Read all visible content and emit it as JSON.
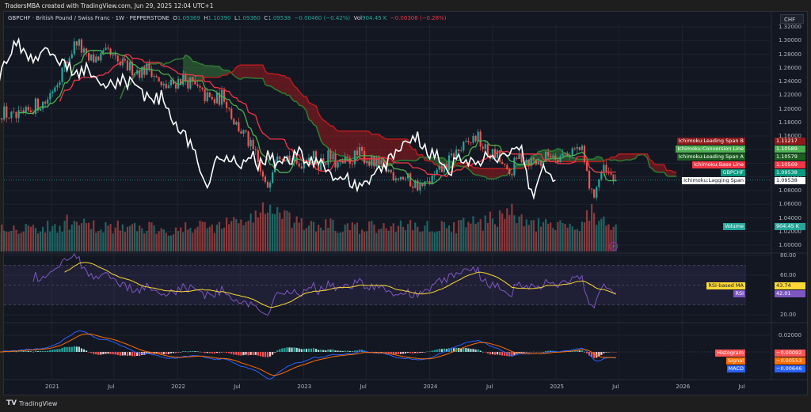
{
  "header": {
    "credit": "TradersMBA created with TradingView.com, Jun 29, 2025 12:04 UTC+1",
    "symbol": "GBPCHF · British Pound / Swiss Franc · 1W · PEPPERSTONE",
    "o_label": "O",
    "o": "1.09369",
    "h_label": "H",
    "h": "1.10390",
    "l_label": "L",
    "l": "1.09360",
    "c_label": "C",
    "c": "1.09538",
    "change": "−0.00460 (−0.42%)",
    "vol_label": "Vol",
    "vol": "904.45 K",
    "vol_change": "−0.00308 (−0.28%)"
  },
  "currency_button": "CHF",
  "footer": {
    "logo": "TV",
    "brand": "TradingView"
  },
  "colors": {
    "background": "#131722",
    "up": "#26a69a",
    "down": "#ef5350",
    "conversion": "#4caf50",
    "base": "#f23645",
    "span_a": "#2e7d32",
    "span_b": "#b71c1c",
    "lagging": "#ffffff",
    "rsi": "#7e57c2",
    "rsi_ma": "#fdd835",
    "macd": "#2962ff",
    "signal": "#ff6d00",
    "hist_pos": "#26a69a",
    "hist_neg": "#ff5252"
  },
  "labels": {
    "span_b": {
      "name": "Ichimoku:Leading Span B",
      "value": "1.11217"
    },
    "conversion": {
      "name": "Ichimoku:Conversion Line",
      "value": "1.10589"
    },
    "span_a": {
      "name": "Ichimoku:Leading Span A",
      "value": "1.10579"
    },
    "base": {
      "name": "Ichimoku:Base Line",
      "value": "1.10569"
    },
    "price": {
      "name": "GBPCHF",
      "value": "1.09538"
    },
    "lagging": {
      "name": "Ichimoku:Lagging Span",
      "value": "1.09538"
    },
    "volume": {
      "name": "Volume",
      "value": "904.45 K"
    },
    "rsi_ma": {
      "name": "RSI-based MA",
      "value": "43.74"
    },
    "rsi": {
      "name": "RSI",
      "value": "42.01"
    },
    "histogram": {
      "name": "Histogram",
      "value": "−0.00092"
    },
    "signal": {
      "name": "Signal",
      "value": "−0.00553"
    },
    "macd": {
      "name": "MACD",
      "value": "−0.00646"
    }
  },
  "chart_data": {
    "type": "candlestick",
    "interval": "1W",
    "indicators": [
      "Ichimoku Cloud",
      "Volume",
      "RSI",
      "MACD"
    ],
    "y_ticks": [
      "1.32000",
      "1.30000",
      "1.28000",
      "1.26000",
      "1.24000",
      "1.22000",
      "1.20000",
      "1.18000",
      "1.16000",
      "1.14000",
      "1.12000",
      "1.10000",
      "1.08000",
      "1.06000",
      "1.04000",
      "1.02000",
      "1.00000"
    ],
    "ylim": [
      1.0,
      1.32
    ],
    "rsi_ticks": [
      "80.00",
      "60.00",
      "20.00"
    ],
    "macd_ticks": [
      "0.02000"
    ],
    "x_ticks": [
      {
        "label": "2021",
        "date": "2021-01"
      },
      {
        "label": "Jul",
        "date": "2021-07"
      },
      {
        "label": "2022",
        "date": "2022-01"
      },
      {
        "label": "Jul",
        "date": "2022-07"
      },
      {
        "label": "2023",
        "date": "2023-01"
      },
      {
        "label": "Jul",
        "date": "2023-07"
      },
      {
        "label": "2024",
        "date": "2024-01"
      },
      {
        "label": "Jul",
        "date": "2024-07"
      },
      {
        "label": "2025",
        "date": "2025-01"
      },
      {
        "label": "Jul",
        "date": "2025-07"
      },
      {
        "label": "2026",
        "date": "2026-01"
      },
      {
        "label": "Jul",
        "date": "2026-07"
      }
    ],
    "last_candle": {
      "open": 1.09369,
      "high": 1.1039,
      "low": 1.0936,
      "close": 1.09538,
      "volume_k": 904.45
    },
    "monthly": [
      [
        "2020-08",
        1.195,
        850
      ],
      [
        "2020-09",
        1.185,
        800
      ],
      [
        "2020-10",
        1.19,
        820
      ],
      [
        "2020-11",
        1.205,
        800
      ],
      [
        "2020-12",
        1.21,
        780
      ],
      [
        "2021-01",
        1.24,
        850
      ],
      [
        "2021-02",
        1.27,
        950
      ],
      [
        "2021-03",
        1.3,
        900
      ],
      [
        "2021-04",
        1.27,
        850
      ],
      [
        "2021-05",
        1.275,
        800
      ],
      [
        "2021-06",
        1.28,
        850
      ],
      [
        "2021-07",
        1.265,
        830
      ],
      [
        "2021-08",
        1.26,
        760
      ],
      [
        "2021-09",
        1.255,
        780
      ],
      [
        "2021-10",
        1.26,
        820
      ],
      [
        "2021-11",
        1.23,
        800
      ],
      [
        "2021-12",
        1.235,
        700
      ],
      [
        "2022-01",
        1.245,
        720
      ],
      [
        "2022-02",
        1.235,
        820
      ],
      [
        "2022-03",
        1.22,
        900
      ],
      [
        "2022-04",
        1.21,
        830
      ],
      [
        "2022-05",
        1.22,
        900
      ],
      [
        "2022-06",
        1.18,
        1000
      ],
      [
        "2022-07",
        1.16,
        1050
      ],
      [
        "2022-08",
        1.13,
        1150
      ],
      [
        "2022-09",
        1.08,
        1550
      ],
      [
        "2022-10",
        1.14,
        1250
      ],
      [
        "2022-11",
        1.13,
        1050
      ],
      [
        "2022-12",
        1.115,
        900
      ],
      [
        "2023-01",
        1.135,
        850
      ],
      [
        "2023-02",
        1.12,
        800
      ],
      [
        "2023-03",
        1.13,
        900
      ],
      [
        "2023-04",
        1.115,
        750
      ],
      [
        "2023-05",
        1.125,
        780
      ],
      [
        "2023-06",
        1.135,
        760
      ],
      [
        "2023-07",
        1.12,
        800
      ],
      [
        "2023-08",
        1.115,
        760
      ],
      [
        "2023-09",
        1.105,
        800
      ],
      [
        "2023-10",
        1.1,
        900
      ],
      [
        "2023-11",
        1.09,
        850
      ],
      [
        "2023-12",
        1.085,
        820
      ],
      [
        "2024-01",
        1.1,
        850
      ],
      [
        "2024-02",
        1.115,
        800
      ],
      [
        "2024-03",
        1.135,
        850
      ],
      [
        "2024-04",
        1.145,
        900
      ],
      [
        "2024-05",
        1.16,
        950
      ],
      [
        "2024-06",
        1.135,
        1000
      ],
      [
        "2024-07",
        1.13,
        1100
      ],
      [
        "2024-08",
        1.1,
        1500
      ],
      [
        "2024-09",
        1.13,
        1000
      ],
      [
        "2024-10",
        1.125,
        900
      ],
      [
        "2024-11",
        1.12,
        850
      ],
      [
        "2024-12",
        1.135,
        850
      ],
      [
        "2025-01",
        1.13,
        820
      ],
      [
        "2025-02",
        1.14,
        850
      ],
      [
        "2025-03",
        1.14,
        950
      ],
      [
        "2025-04",
        1.07,
        1400
      ],
      [
        "2025-05",
        1.11,
        950
      ],
      [
        "2025-06",
        1.0954,
        880
      ]
    ]
  }
}
